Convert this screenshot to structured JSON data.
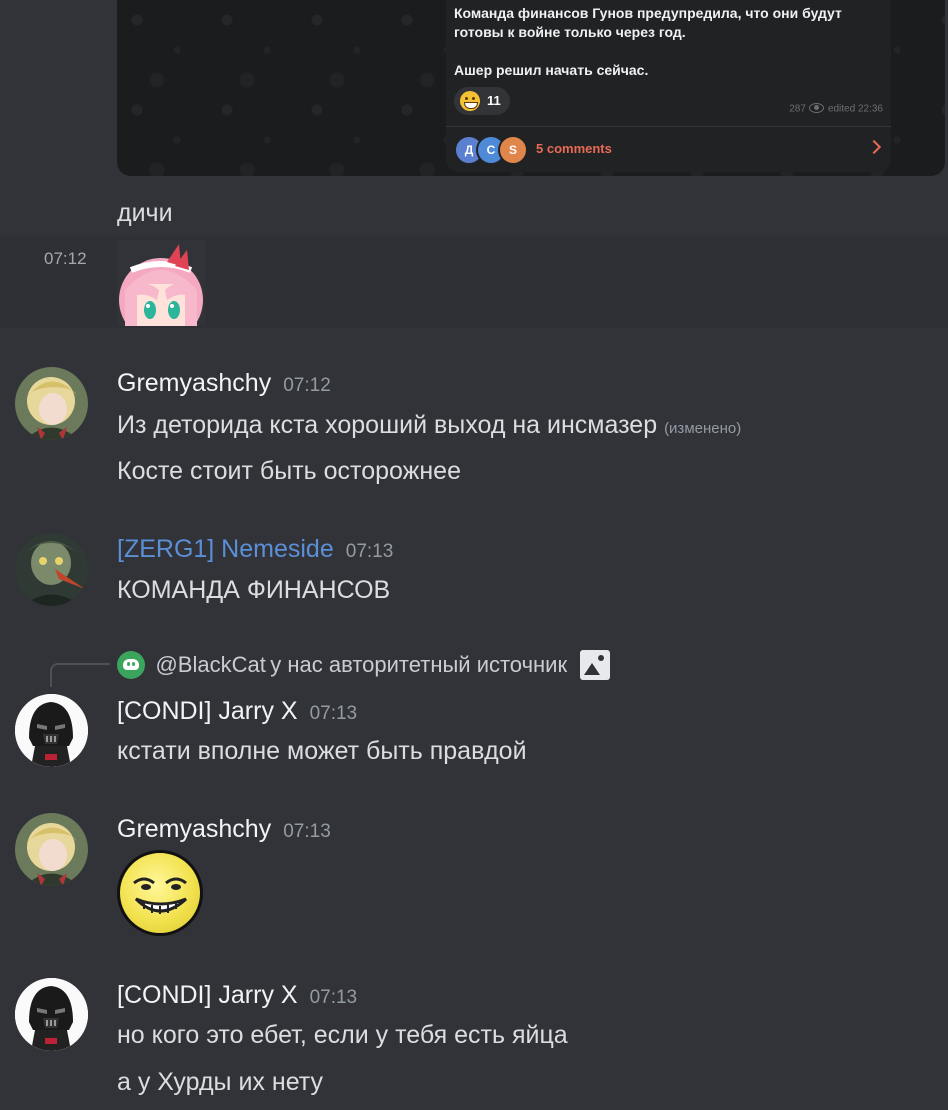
{
  "telegram_embed": {
    "post_text": "Команда финансов Гунов предупредила, что они будут готовы к войне только через год.\n\nАшер решил начать сейчас.",
    "reaction_count": "11",
    "views": "287",
    "edited": "edited 22:36",
    "commenter_initials": [
      "Д",
      "С",
      "S"
    ],
    "comments_label": "5 comments"
  },
  "messages": [
    {
      "text": "дичи"
    },
    {
      "timestamp": "07:12",
      "content": "sticker"
    },
    {
      "author": "Gremyashchy",
      "author_color": "#f2f3f5",
      "time": "07:12",
      "lines": [
        "Из деторида кста хороший выход на инсмазер",
        "Косте стоит быть осторожнее"
      ],
      "edited_label": "(изменено)"
    },
    {
      "author": "[ZERG1] Nemeside",
      "author_color": "#5b8fd6",
      "time": "07:13",
      "lines": [
        "КОМАНДА ФИНАНСОВ"
      ]
    },
    {
      "reply": {
        "mention": "@BlackCat",
        "text": "у нас авторитетный источник"
      },
      "author": "[CONDI] Jarry X",
      "author_color": "#f2f3f5",
      "time": "07:13",
      "lines": [
        "кстати вполне может быть правдой"
      ]
    },
    {
      "author": "Gremyashchy",
      "author_color": "#f2f3f5",
      "time": "07:13",
      "content": "emoji-gif"
    },
    {
      "author": "[CONDI] Jarry X",
      "author_color": "#f2f3f5",
      "time": "07:13",
      "lines": [
        "но кого это ебет, если у тебя есть яйца",
        "а у  Хурды их нету"
      ]
    }
  ]
}
